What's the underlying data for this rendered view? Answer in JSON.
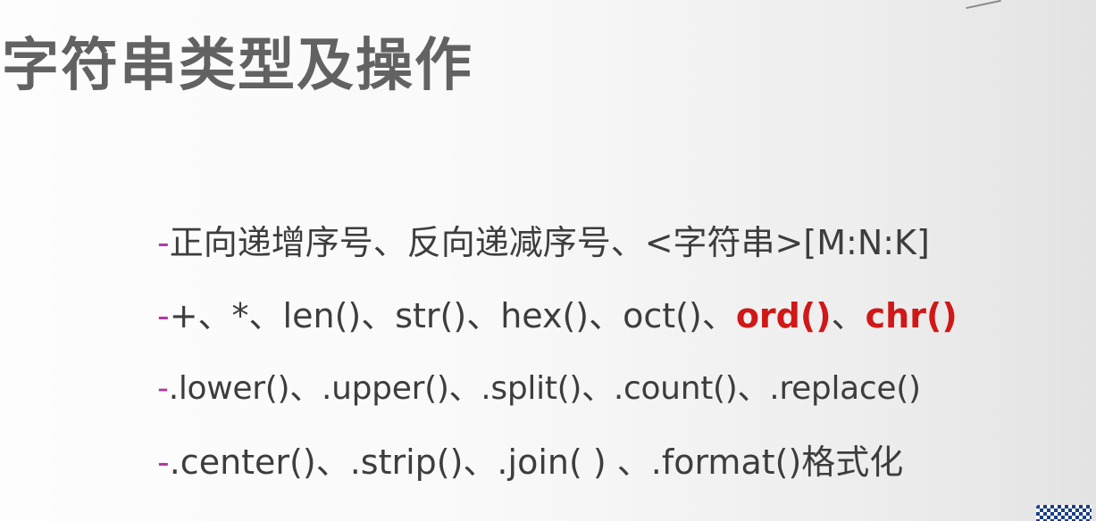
{
  "slide": {
    "title": "字符串类型及操作",
    "bullets": [
      {
        "dash": "-",
        "parts": [
          "正向递增序号、反向递减序号、<字符串>[M:N:K]"
        ]
      },
      {
        "dash": "-",
        "parts": [
          "+、*、len()、str()、hex()、oct()、",
          "ord()",
          "、",
          "chr()"
        ]
      },
      {
        "dash": "-",
        "parts": [
          ".lower()、.upper()、.split()、.count()、.replace()"
        ]
      },
      {
        "dash": "-",
        "parts": [
          ".center()、.strip()、.join( ) 、.format()格式化"
        ]
      }
    ]
  },
  "colors": {
    "title": "#626262",
    "text": "#3d3d3d",
    "dash": "#b03aa3",
    "highlight": "#d01818"
  }
}
